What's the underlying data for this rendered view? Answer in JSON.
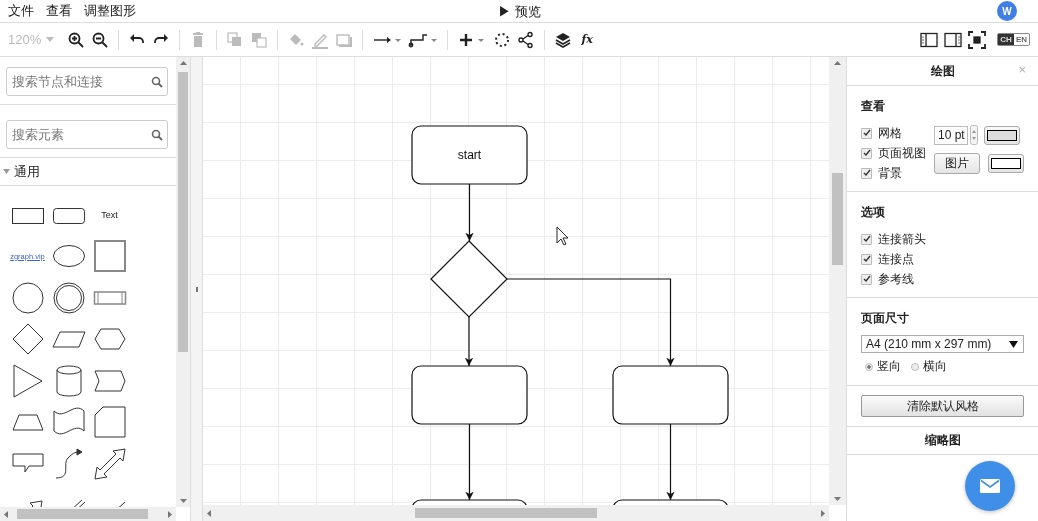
{
  "menu": [
    "文件",
    "查看",
    "调整图形"
  ],
  "preview": "▶ 预览",
  "avatar": "W",
  "toolbar": {
    "zoom": {
      "value": "120%",
      "disabled": true
    },
    "groups": [
      [
        {
          "kind": "zoom-in",
          "disabled": false
        },
        {
          "kind": "zoom-out",
          "disabled": false
        }
      ],
      [
        {
          "kind": "undo",
          "disabled": false
        },
        {
          "kind": "redo",
          "disabled": false
        }
      ],
      [
        {
          "kind": "delete",
          "disabled": true
        }
      ],
      [
        {
          "kind": "to-front",
          "disabled": true
        },
        {
          "kind": "to-back",
          "disabled": true
        }
      ],
      [
        {
          "kind": "fill",
          "disabled": true
        },
        {
          "kind": "line-color",
          "disabled": true
        },
        {
          "kind": "shadow",
          "disabled": true
        }
      ],
      [
        {
          "kind": "connection",
          "disabled": false
        },
        {
          "kind": "waypoint",
          "disabled": false
        }
      ],
      [
        {
          "kind": "insert",
          "disabled": false
        },
        {
          "kind": "dotted-circle",
          "disabled": false
        },
        {
          "kind": "share",
          "disabled": false
        }
      ],
      [
        {
          "kind": "layers",
          "disabled": false
        },
        {
          "kind": "function",
          "label": "fx",
          "disabled": false
        }
      ]
    ],
    "view": [
      {
        "kind": "panel-left"
      },
      {
        "kind": "panel-right"
      },
      {
        "kind": "fullscreen"
      }
    ],
    "language": [
      {
        "label": "CH",
        "selected": true
      },
      {
        "label": "EN",
        "selected": false
      }
    ]
  },
  "sidebar": {
    "search_nodes": {
      "placeholder": "搜索节点和连接"
    },
    "search_shapes": {
      "placeholder": "搜索元素"
    },
    "section": {
      "title": "通用",
      "expanded": true
    },
    "shapes": [
      {
        "kind": "rect"
      },
      {
        "kind": "rounded"
      },
      {
        "kind": "text",
        "label": "Text"
      },
      {
        "kind": "link",
        "label": "zgraph.vip"
      },
      {
        "kind": "ellipse"
      },
      {
        "kind": "square"
      },
      {
        "kind": "circle"
      },
      {
        "kind": "double-circle"
      },
      {
        "kind": "process"
      },
      {
        "kind": "diamond"
      },
      {
        "kind": "parallelogram"
      },
      {
        "kind": "hexagon"
      },
      {
        "kind": "triangle"
      },
      {
        "kind": "cylinder"
      },
      {
        "kind": "step"
      },
      {
        "kind": "trapezoid"
      },
      {
        "kind": "tape"
      },
      {
        "kind": "card"
      },
      {
        "kind": "callout"
      },
      {
        "kind": "curve"
      },
      {
        "kind": "double-arrow"
      },
      {
        "kind": "arrow"
      },
      {
        "kind": "double-line"
      },
      {
        "kind": "line"
      }
    ]
  },
  "diagram": {
    "nodes": [
      {
        "kind": "process",
        "label": "start"
      },
      {
        "kind": "decision"
      },
      {
        "kind": "process"
      },
      {
        "kind": "process"
      },
      {
        "kind": "process"
      },
      {
        "kind": "process"
      }
    ],
    "edges": [
      {
        "kind": "straight"
      },
      {
        "kind": "straight"
      },
      {
        "kind": "elbow"
      },
      {
        "kind": "straight"
      },
      {
        "kind": "straight"
      }
    ]
  },
  "panel": {
    "title": "绘图",
    "close": "×",
    "view": {
      "title": "查看",
      "options": [
        {
          "label": "网格",
          "checked": true
        },
        {
          "label": "页面视图",
          "checked": true
        },
        {
          "label": "背景",
          "checked": true
        }
      ],
      "grid_size": "10 pt",
      "background_button": "图片"
    },
    "options": {
      "title": "选项",
      "options": [
        {
          "label": "连接箭头",
          "checked": true
        },
        {
          "label": "连接点",
          "checked": true
        },
        {
          "label": "参考线",
          "checked": true
        }
      ]
    },
    "page_size": {
      "title": "页面尺寸",
      "value": "A4 (210 mm x 297 mm)",
      "orientations": [
        {
          "label": "竖向",
          "selected": true
        },
        {
          "label": "横向",
          "selected": false
        }
      ]
    },
    "reset_button": "清除默认风格",
    "outline_title": "缩略图"
  }
}
